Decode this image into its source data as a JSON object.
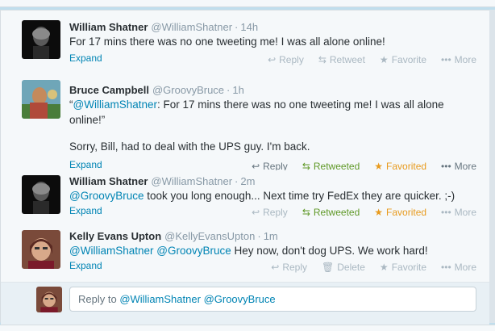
{
  "tweets": [
    {
      "fullname": "William Shatner",
      "username": "@WilliamShatner",
      "time": "14h",
      "text": "For 17 mins there was no one tweeting me! I was all alone online!",
      "expand": "Expand",
      "actions": {
        "reply": "Reply",
        "retweet": "Retweet",
        "favorite": "Favorite",
        "more": "More"
      }
    },
    {
      "fullname": "Bruce Campbell",
      "username": "@GroovyBruce",
      "time": "1h",
      "quote_open": "“",
      "mention": "@WilliamShatner",
      "text_after_mention": ": For 17 mins there was no one tweeting me! I was all alone online!”",
      "text_second": "Sorry, Bill, had to deal with the UPS guy. I'm back.",
      "expand": "Expand",
      "actions": {
        "reply": "Reply",
        "retweet": "Retweeted",
        "favorite": "Favorited",
        "more": "More"
      }
    },
    {
      "fullname": "William Shatner",
      "username": "@WilliamShatner",
      "time": "2m",
      "mention": "@GroovyBruce",
      "text_after_mention": " took you long enough... Next time try FedEx they are quicker. ;-)",
      "expand": "Expand",
      "actions": {
        "reply": "Reply",
        "retweet": "Retweeted",
        "favorite": "Favorited",
        "more": "More"
      }
    },
    {
      "fullname": "Kelly Evans Upton",
      "username": "@KellyEvansUpton",
      "time": "1m",
      "mention1": "@WilliamShatner",
      "mention2": "@GroovyBruce",
      "text_after_mention": " Hey now, don't dog UPS. We work hard!",
      "expand": "Expand",
      "actions": {
        "reply": "Reply",
        "delete": "Delete",
        "favorite": "Favorite",
        "more": "More"
      }
    }
  ],
  "reply_box": {
    "prefix": "Reply to ",
    "mention1": "@WilliamShatner",
    "mention2": "@GroovyBruce"
  },
  "separator_dot": "·",
  "colors": {
    "link": "#0084b4",
    "retweeted": "#609928",
    "favorited": "#e89b1e",
    "thread_line": "#4aa3df",
    "muted": "#8899a6"
  },
  "icons": {
    "reply": "reply-arrow-icon",
    "retweet": "retweet-icon",
    "favorite": "star-icon",
    "more": "more-dots-icon",
    "delete": "trash-icon"
  }
}
